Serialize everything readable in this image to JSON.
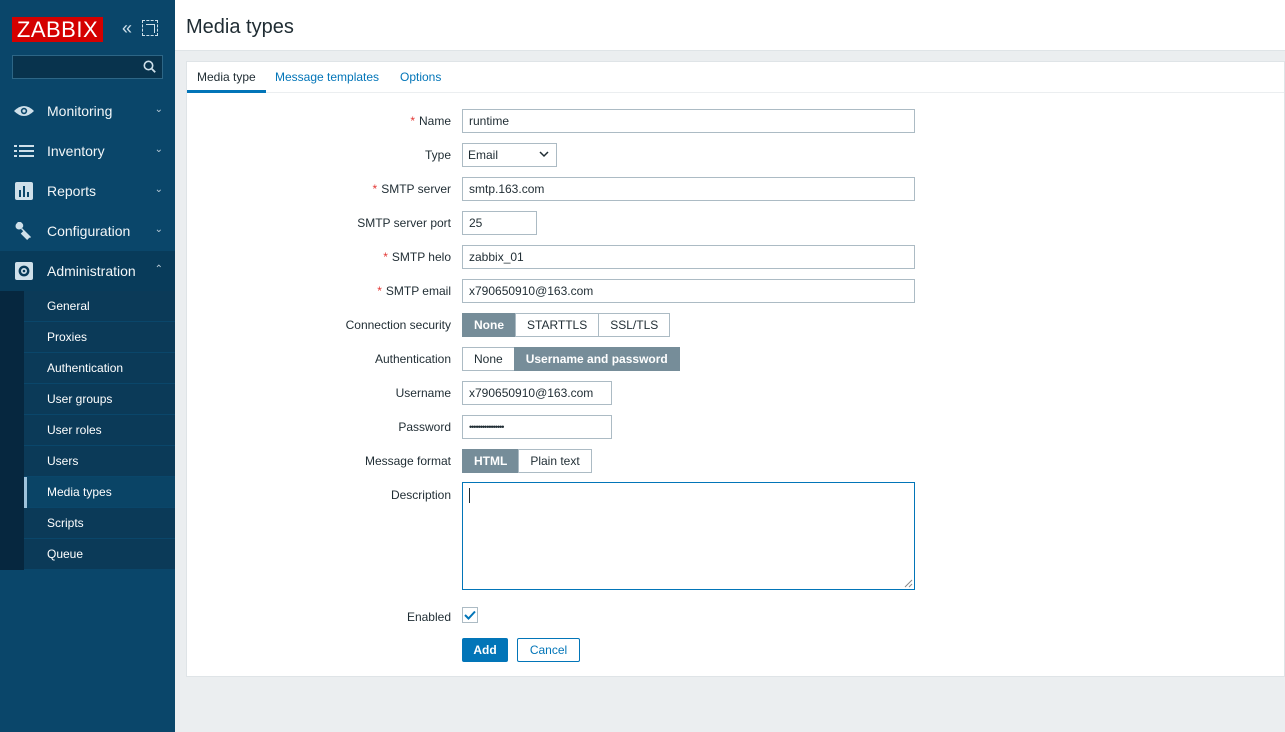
{
  "app": {
    "logo_text": "ZABBIX",
    "search_placeholder": ""
  },
  "sidebar": {
    "menu": [
      {
        "label": "Monitoring",
        "icon": "eye-icon"
      },
      {
        "label": "Inventory",
        "icon": "list-icon"
      },
      {
        "label": "Reports",
        "icon": "bar-chart-icon"
      },
      {
        "label": "Configuration",
        "icon": "wrench-icon"
      },
      {
        "label": "Administration",
        "icon": "gear-icon"
      }
    ],
    "submenu": [
      "General",
      "Proxies",
      "Authentication",
      "User groups",
      "User roles",
      "Users",
      "Media types",
      "Scripts",
      "Queue"
    ],
    "selected_submenu": "Media types"
  },
  "page": {
    "title": "Media types"
  },
  "tabs": [
    "Media type",
    "Message templates",
    "Options"
  ],
  "form": {
    "name": {
      "label": "Name",
      "value": "runtime"
    },
    "type": {
      "label": "Type",
      "value": "Email"
    },
    "smtp_server": {
      "label": "SMTP server",
      "value": "smtp.163.com"
    },
    "smtp_port": {
      "label": "SMTP server port",
      "value": "25"
    },
    "smtp_helo": {
      "label": "SMTP helo",
      "value": "zabbix_01"
    },
    "smtp_email": {
      "label": "SMTP email",
      "value": "x790650910@163.com"
    },
    "connection_security": {
      "label": "Connection security",
      "options": [
        "None",
        "STARTTLS",
        "SSL/TLS"
      ],
      "selected": "None"
    },
    "authentication": {
      "label": "Authentication",
      "options": [
        "None",
        "Username and password"
      ],
      "selected": "Username and password"
    },
    "username": {
      "label": "Username",
      "value": "x790650910@163.com"
    },
    "password": {
      "label": "Password",
      "value": "••••••••••••••••"
    },
    "message_format": {
      "label": "Message format",
      "options": [
        "HTML",
        "Plain text"
      ],
      "selected": "HTML"
    },
    "description": {
      "label": "Description",
      "value": ""
    },
    "enabled": {
      "label": "Enabled",
      "checked": true
    },
    "add_label": "Add",
    "cancel_label": "Cancel"
  },
  "colors": {
    "sidebar": "#0a466a",
    "brand": "#d40000",
    "link": "#0275b8",
    "segment_on": "#768d99",
    "required": "#e33734"
  }
}
